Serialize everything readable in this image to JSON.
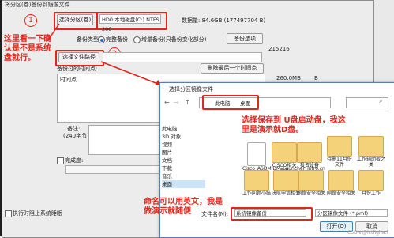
{
  "main": {
    "title": "将分区(卷)备份到镜像文件",
    "btn_select_partition": "选择分区(卷)",
    "partition_value": "HD0:本地磁盘(C:) NTFS 200",
    "data_size": "数据量: 84.6GB (177497704 B)",
    "backup_type_label": "备份类型:",
    "radio_full": "完整备份",
    "radio_incremental": "增量备份(只备份变化部分)",
    "backup_options_button": "备份选项",
    "btn_select_file_path": "选择文件路径",
    "time_points_label": "备份过的时间点:",
    "delete_time_point_button": "删除最后一个时间点",
    "col_time_point": "时间点",
    "num_1": "215216",
    "num_2": "260.0MB",
    "num_3": "B",
    "notes_label": "备注:",
    "notes_sub": "(240字节)",
    "progress_label": "完成度:",
    "after_done_label": "执行时阻止系统睡眠"
  },
  "badges": {
    "one": "1",
    "two": "2"
  },
  "annotations": {
    "left_note": "这里看一下确认是不是系统盘就行。",
    "right_note": "选择保存到 U盘启动盘，我这里是演示就D盘。",
    "bottom_note": "命名可以用英文，我是做演示就随便"
  },
  "dialog": {
    "title": "选择分区镜像文件",
    "breadcrumb": [
      "此电脑",
      "桌面"
    ],
    "sidebar": [
      "此电脑",
      "3D 对象",
      "视频",
      "图片",
      "文档",
      "下载",
      "音乐",
      "桌面"
    ],
    "files_row1": [
      "Cisco_ASDMIDM_Launcher_intro.cn",
      "CISCO相关手册",
      "投资设备",
      "待删11月份文件",
      "工作辅助板之类"
    ],
    "files_row2": [
      "工作问题小结",
      "决航申请相关",
      "网络安全相关",
      "网络安全相关",
      "月份工作"
    ],
    "filename_label": "文件名(N):",
    "filename_value": "系统镜像备份",
    "filetype_value": "分区镜像文件 (*.pmf)",
    "open_button": "打开(O)",
    "cancel_button": "取消"
  },
  "watermark": "CSDN @ictfigha.f",
  "colors": {
    "accent": "#e0251b",
    "dialog_border": "#5a7cae"
  }
}
